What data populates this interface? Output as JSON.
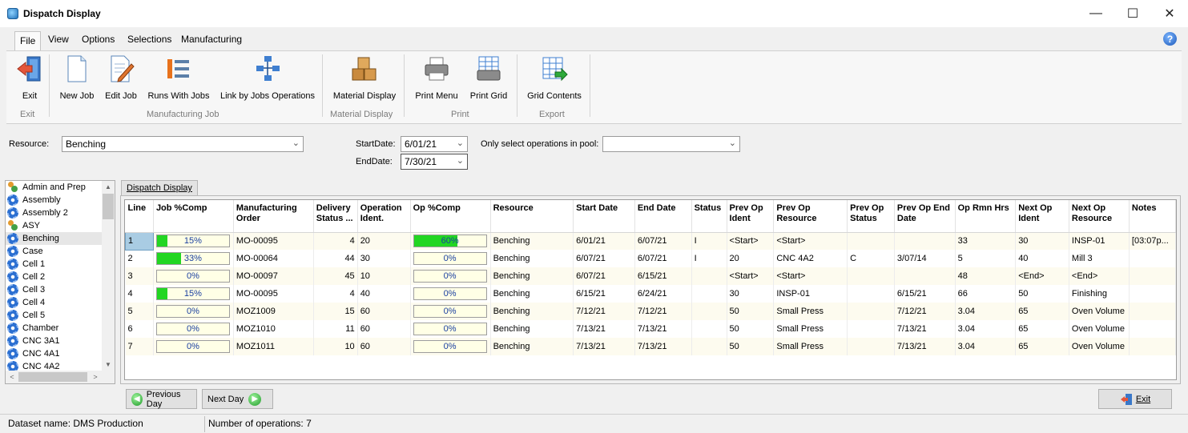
{
  "window": {
    "title": "Dispatch Display",
    "controls": [
      "—",
      "☐",
      "✕"
    ]
  },
  "menu": [
    "File",
    "View",
    "Options",
    "Selections",
    "Manufacturing"
  ],
  "ribbon": {
    "buttons": [
      {
        "label": "Exit",
        "icon": "exit-door-icon"
      },
      {
        "label": "New Job",
        "icon": "new-document-icon"
      },
      {
        "label": "Edit Job",
        "icon": "edit-document-icon"
      },
      {
        "label": "Runs With Jobs",
        "icon": "runs-list-icon"
      },
      {
        "label": "Link by Jobs Operations",
        "icon": "link-network-icon"
      },
      {
        "label": "Material Display",
        "icon": "boxes-icon"
      },
      {
        "label": "Print Menu",
        "icon": "printer-icon"
      },
      {
        "label": "Print Grid",
        "icon": "print-grid-icon"
      },
      {
        "label": "Grid Contents",
        "icon": "export-grid-icon"
      }
    ],
    "groups": [
      "Exit",
      "Manufacturing Job",
      "Material Display",
      "Print",
      "Export"
    ]
  },
  "filters": {
    "resource_label": "Resource:",
    "resource_value": "Benching",
    "start_label": "StartDate:",
    "start_value": "6/01/21",
    "end_label": "EndDate:",
    "end_value": "7/30/21",
    "pool_label": "Only select operations in pool:",
    "pool_value": ""
  },
  "resources": [
    {
      "name": "Admin and Prep",
      "icon": "people"
    },
    {
      "name": "Assembly",
      "icon": "gear"
    },
    {
      "name": "Assembly 2",
      "icon": "gear"
    },
    {
      "name": "ASY",
      "icon": "people"
    },
    {
      "name": "Benching",
      "icon": "gear",
      "selected": true
    },
    {
      "name": "Case",
      "icon": "gear"
    },
    {
      "name": "Cell 1",
      "icon": "gear"
    },
    {
      "name": "Cell 2",
      "icon": "gear"
    },
    {
      "name": "Cell 3",
      "icon": "gear"
    },
    {
      "name": "Cell 4",
      "icon": "gear"
    },
    {
      "name": "Cell 5",
      "icon": "gear"
    },
    {
      "name": "Chamber",
      "icon": "gear"
    },
    {
      "name": "CNC 3A1",
      "icon": "gear"
    },
    {
      "name": "CNC 4A1",
      "icon": "gear"
    },
    {
      "name": "CNC 4A2",
      "icon": "gear"
    }
  ],
  "tab_label": "Dispatch Display",
  "grid": {
    "columns": [
      "Line",
      "Job %Comp",
      "Manufacturing Order",
      "Delivery Status ...",
      "Operation Ident.",
      "Op %Comp",
      "Resource",
      "Start Date",
      "End Date",
      "Status",
      "Prev Op Ident",
      "Prev Op Resource",
      "Prev Op Status",
      "Prev Op End Date",
      "Op Rmn Hrs",
      "Next Op Ident",
      "Next Op Resource",
      "Notes"
    ],
    "rows": [
      {
        "line": "1",
        "job_pct": 0.15,
        "job_txt": "15%",
        "mo": "MO-00095",
        "delivery": "4",
        "op": "20",
        "op_pct": 0.6,
        "op_txt": "60%",
        "resource": "Benching",
        "start": "6/01/21",
        "end": "6/07/21",
        "status": "I",
        "prev_ident": "<Start>",
        "prev_res": "<Start>",
        "prev_status": "",
        "prev_end": "",
        "rmn": "33",
        "next_ident": "30",
        "next_res": "INSP-01",
        "notes": "[03:07p..."
      },
      {
        "line": "2",
        "job_pct": 0.33,
        "job_txt": "33%",
        "mo": "MO-00064",
        "delivery": "44",
        "op": "30",
        "op_pct": 0.0,
        "op_txt": "0%",
        "resource": "Benching",
        "start": "6/07/21",
        "end": "6/07/21",
        "status": "I",
        "prev_ident": "20",
        "prev_res": "CNC 4A2",
        "prev_status": "C",
        "prev_end": "3/07/14",
        "rmn": "5",
        "next_ident": "40",
        "next_res": "Mill 3",
        "notes": ""
      },
      {
        "line": "3",
        "job_pct": 0.0,
        "job_txt": "0%",
        "mo": "MO-00097",
        "delivery": "45",
        "op": "10",
        "op_pct": 0.0,
        "op_txt": "0%",
        "resource": "Benching",
        "start": "6/07/21",
        "end": "6/15/21",
        "status": "",
        "prev_ident": "<Start>",
        "prev_res": "<Start>",
        "prev_status": "",
        "prev_end": "",
        "rmn": "48",
        "next_ident": "<End>",
        "next_res": "<End>",
        "notes": ""
      },
      {
        "line": "4",
        "job_pct": 0.15,
        "job_txt": "15%",
        "mo": "MO-00095",
        "delivery": "4",
        "op": "40",
        "op_pct": 0.0,
        "op_txt": "0%",
        "resource": "Benching",
        "start": "6/15/21",
        "end": "6/24/21",
        "status": "",
        "prev_ident": "30",
        "prev_res": "INSP-01",
        "prev_status": "",
        "prev_end": "6/15/21",
        "rmn": "66",
        "next_ident": "50",
        "next_res": "Finishing",
        "notes": ""
      },
      {
        "line": "5",
        "job_pct": 0.0,
        "job_txt": "0%",
        "mo": "MOZ1009",
        "delivery": "15",
        "op": "60",
        "op_pct": 0.0,
        "op_txt": "0%",
        "resource": "Benching",
        "start": "7/12/21",
        "end": "7/12/21",
        "status": "",
        "prev_ident": "50",
        "prev_res": "Small Press",
        "prev_status": "",
        "prev_end": "7/12/21",
        "rmn": "3.04",
        "next_ident": "65",
        "next_res": "Oven Volume",
        "notes": ""
      },
      {
        "line": "6",
        "job_pct": 0.0,
        "job_txt": "0%",
        "mo": "MOZ1010",
        "delivery": "11",
        "op": "60",
        "op_pct": 0.0,
        "op_txt": "0%",
        "resource": "Benching",
        "start": "7/13/21",
        "end": "7/13/21",
        "status": "",
        "prev_ident": "50",
        "prev_res": "Small Press",
        "prev_status": "",
        "prev_end": "7/13/21",
        "rmn": "3.04",
        "next_ident": "65",
        "next_res": "Oven Volume",
        "notes": ""
      },
      {
        "line": "7",
        "job_pct": 0.0,
        "job_txt": "0%",
        "mo": "MOZ1011",
        "delivery": "10",
        "op": "60",
        "op_pct": 0.0,
        "op_txt": "0%",
        "resource": "Benching",
        "start": "7/13/21",
        "end": "7/13/21",
        "status": "",
        "prev_ident": "50",
        "prev_res": "Small Press",
        "prev_status": "",
        "prev_end": "7/13/21",
        "rmn": "3.04",
        "next_ident": "65",
        "next_res": "Oven Volume",
        "notes": ""
      }
    ]
  },
  "buttons": {
    "prev_day": "Previous Day",
    "next_day": "Next Day",
    "exit": "Exit"
  },
  "status": {
    "dataset": "Dataset name:  DMS Production",
    "count": "Number of operations: 7"
  },
  "colors": {
    "progress_fill": "#22d622",
    "progress_bg": "#ffffe6",
    "row_alt": "#fdfbef",
    "selected_line": "#a9cce3"
  }
}
